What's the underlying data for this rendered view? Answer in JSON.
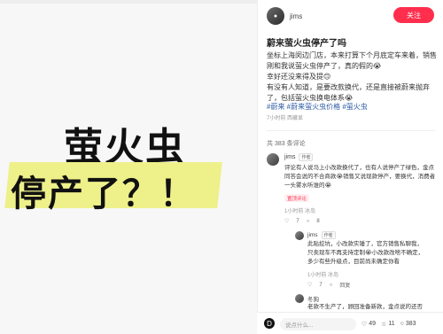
{
  "left": {
    "main_text": "萤火虫",
    "sub_text": "停产了？！"
  },
  "author": {
    "name": "jims",
    "follow": "关注"
  },
  "post": {
    "title": "蔚来萤火虫停产了吗",
    "body_lines": [
      "坐标上海闵边门店，本来打算下个月底定车来着，销售",
      "刚和我说萤火虫停产了，真的假的😭",
      "幸好还没来得及提🙃",
      "有没有人知道，是要改款换代，还是直接被蔚来抛弃",
      "了，包括萤火虫换电体系😭"
    ],
    "tags": "#蔚来 #蔚来萤火虫价格 #萤火虫",
    "meta": "7小时前 西藏显"
  },
  "comments": {
    "count": "共 383 条评论",
    "items": [
      {
        "name": "jims",
        "badge": "作者",
        "text": "评论有人说马上小改款换代了，也有人说停产了绿色，金点同答会说的不合商款😭销售又说现款停产，要换代，消费者一头雾水听谁的😭",
        "stat": "1小时前 冰岛",
        "pill": "置顶评论",
        "like": "7",
        "reply_count": "8"
      }
    ],
    "replies": [
      {
        "name": "jims",
        "badge": "作者",
        "text": "此贴挖坑，小改款实锤了，官方销售私聊我，只卖现车不再支持定制😭小改款改啥不确定，多少有些升级点，目前尚未确定你看",
        "stat": "1小时前 冰岛",
        "like": "7",
        "reply_count": "回复"
      },
      {
        "name": "冬狗",
        "text": "老款不生产了，顾回准备新款，金点说的还否复",
        "stat": ""
      }
    ]
  },
  "bottom": {
    "placeholder": "说点什么...",
    "likes": "49",
    "stars": "11",
    "comments": "383"
  }
}
